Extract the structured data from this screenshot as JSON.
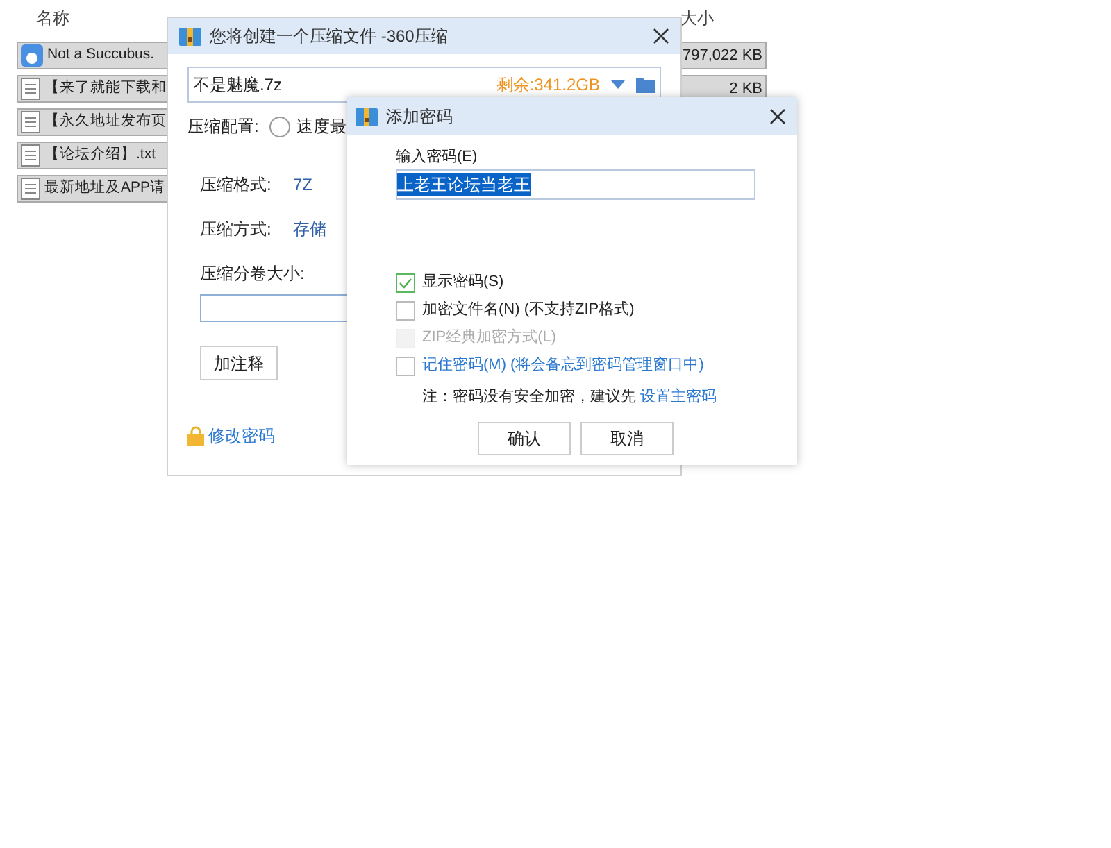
{
  "explorer": {
    "columns": [
      "名称",
      "大小"
    ],
    "files": [
      {
        "kind": "app",
        "name": "Not a Succubus.",
        "size": "797,022 KB"
      },
      {
        "kind": "text",
        "name": "【来了就能下载和",
        "size": "2 KB"
      },
      {
        "kind": "text",
        "name": "【永久地址发布页"
      },
      {
        "kind": "text",
        "name": "【论坛介绍】.txt"
      },
      {
        "kind": "text",
        "name": "最新地址及APP请"
      }
    ]
  },
  "compress_dialog": {
    "title": "您将创建一个压缩文件 -360压缩",
    "filename": "不是魅魔.7z",
    "free_space": "剩余:341.2GB",
    "config_label": "压缩配置:",
    "config_options": [
      {
        "label": "速度最",
        "selected": false
      }
    ],
    "format_label": "压缩格式:",
    "format_value": "7Z",
    "method_label": "压缩方式:",
    "method_value": "存储",
    "volume_label": "压缩分卷大小:",
    "comment_button": "加注释",
    "change_password_link": "修改密码"
  },
  "password_dialog": {
    "title": "添加密码",
    "password_label": "输入密码(E)",
    "password": "上老王论坛当老王",
    "options": [
      {
        "label": "显示密码(S)",
        "checked": true,
        "disabled": false,
        "kind": "plain"
      },
      {
        "label": "加密文件名(N) (不支持ZIP格式)",
        "checked": false,
        "disabled": false,
        "kind": "plain"
      },
      {
        "label": "ZIP经典加密方式(L)",
        "checked": false,
        "disabled": true,
        "kind": "plain"
      },
      {
        "label": "记住密码(M) (将会备忘到密码管理窗口中)",
        "checked": false,
        "disabled": false,
        "kind": "link"
      }
    ],
    "note": "注：密码没有安全加密，建议先",
    "note_link": "设置主密码",
    "buttons": [
      "确认",
      "取消"
    ]
  }
}
